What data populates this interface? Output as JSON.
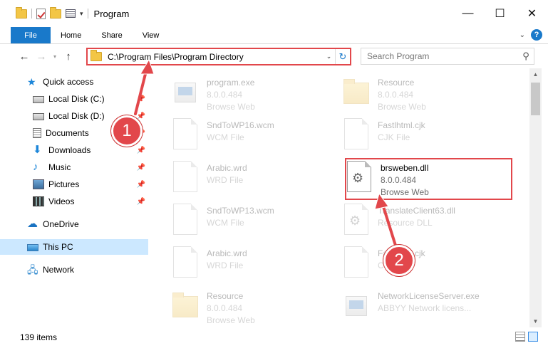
{
  "window": {
    "title": "Program",
    "minimize_glyph": "—",
    "maximize_glyph": "☐",
    "close_glyph": "✕"
  },
  "ribbon": {
    "tabs": [
      "File",
      "Home",
      "Share",
      "View"
    ],
    "expand_glyph": "⌄",
    "help_glyph": "?"
  },
  "address": {
    "back_glyph": "←",
    "forward_glyph": "→",
    "up_glyph": "↑",
    "path": "C:\\Program Files\\Program Directory",
    "dropdown_glyph": "⌄",
    "refresh_glyph": "↻"
  },
  "search": {
    "placeholder": "Search Program",
    "icon_glyph": "⚲"
  },
  "nav": {
    "pin_glyph": "📌",
    "items": [
      {
        "label": "Quick access",
        "icon": "star-icon"
      },
      {
        "label": "Local Disk (C:)",
        "icon": "disk-icon"
      },
      {
        "label": "Local Disk (D:)",
        "icon": "disk-icon"
      },
      {
        "label": "Documents",
        "icon": "documents-icon"
      },
      {
        "label": "Downloads",
        "icon": "download-icon"
      },
      {
        "label": "Music",
        "icon": "music-icon"
      },
      {
        "label": "Pictures",
        "icon": "pictures-icon"
      },
      {
        "label": "Videos",
        "icon": "videos-icon"
      },
      {
        "label": "OneDrive",
        "icon": "cloud-icon"
      },
      {
        "label": "This PC",
        "icon": "computer-icon"
      },
      {
        "label": "Network",
        "icon": "network-icon"
      }
    ]
  },
  "files": [
    {
      "name": "program.exe",
      "line2": "8.0.0.484",
      "line3": "Browse Web",
      "icon": "exe"
    },
    {
      "name": "Resource",
      "line2": "8.0.0.484",
      "line3": "Browse Web",
      "icon": "folder"
    },
    {
      "name": "SndToWP16.wcm",
      "line2": "WCM File",
      "line3": "",
      "icon": "page"
    },
    {
      "name": "Fastlhtml.cjk",
      "line2": "CJK File",
      "line3": "",
      "icon": "page"
    },
    {
      "name": "Arabic.wrd",
      "line2": "WRD File",
      "line3": "",
      "icon": "page"
    },
    {
      "name": "brsweben.dll",
      "line2": "8.0.0.484",
      "line3": "Browse Web",
      "icon": "dll"
    },
    {
      "name": "SndToWP13.wcm",
      "line2": "WCM File",
      "line3": "",
      "icon": "page"
    },
    {
      "name": "TranslateClient63.dll",
      "line2": "Resource DLL",
      "line3": "",
      "icon": "dll"
    },
    {
      "name": "Arabic.wrd",
      "line2": "WRD File",
      "line3": "",
      "icon": "page"
    },
    {
      "name": "Fastlhtml.cjk",
      "line2": "CJK File",
      "line3": "",
      "icon": "page"
    },
    {
      "name": "Resource",
      "line2": "8.0.0.484",
      "line3": "Browse Web",
      "icon": "folder"
    },
    {
      "name": "NetworkLicenseServer.exe",
      "line2": "ABBYY Network licens...",
      "line3": "",
      "icon": "exe"
    }
  ],
  "status": {
    "item_count": "139 items"
  },
  "scrollbar": {
    "up_glyph": "▲",
    "down_glyph": "▼"
  },
  "annotations": {
    "badge1": "1",
    "badge2": "2",
    "color": "#e2474b"
  }
}
